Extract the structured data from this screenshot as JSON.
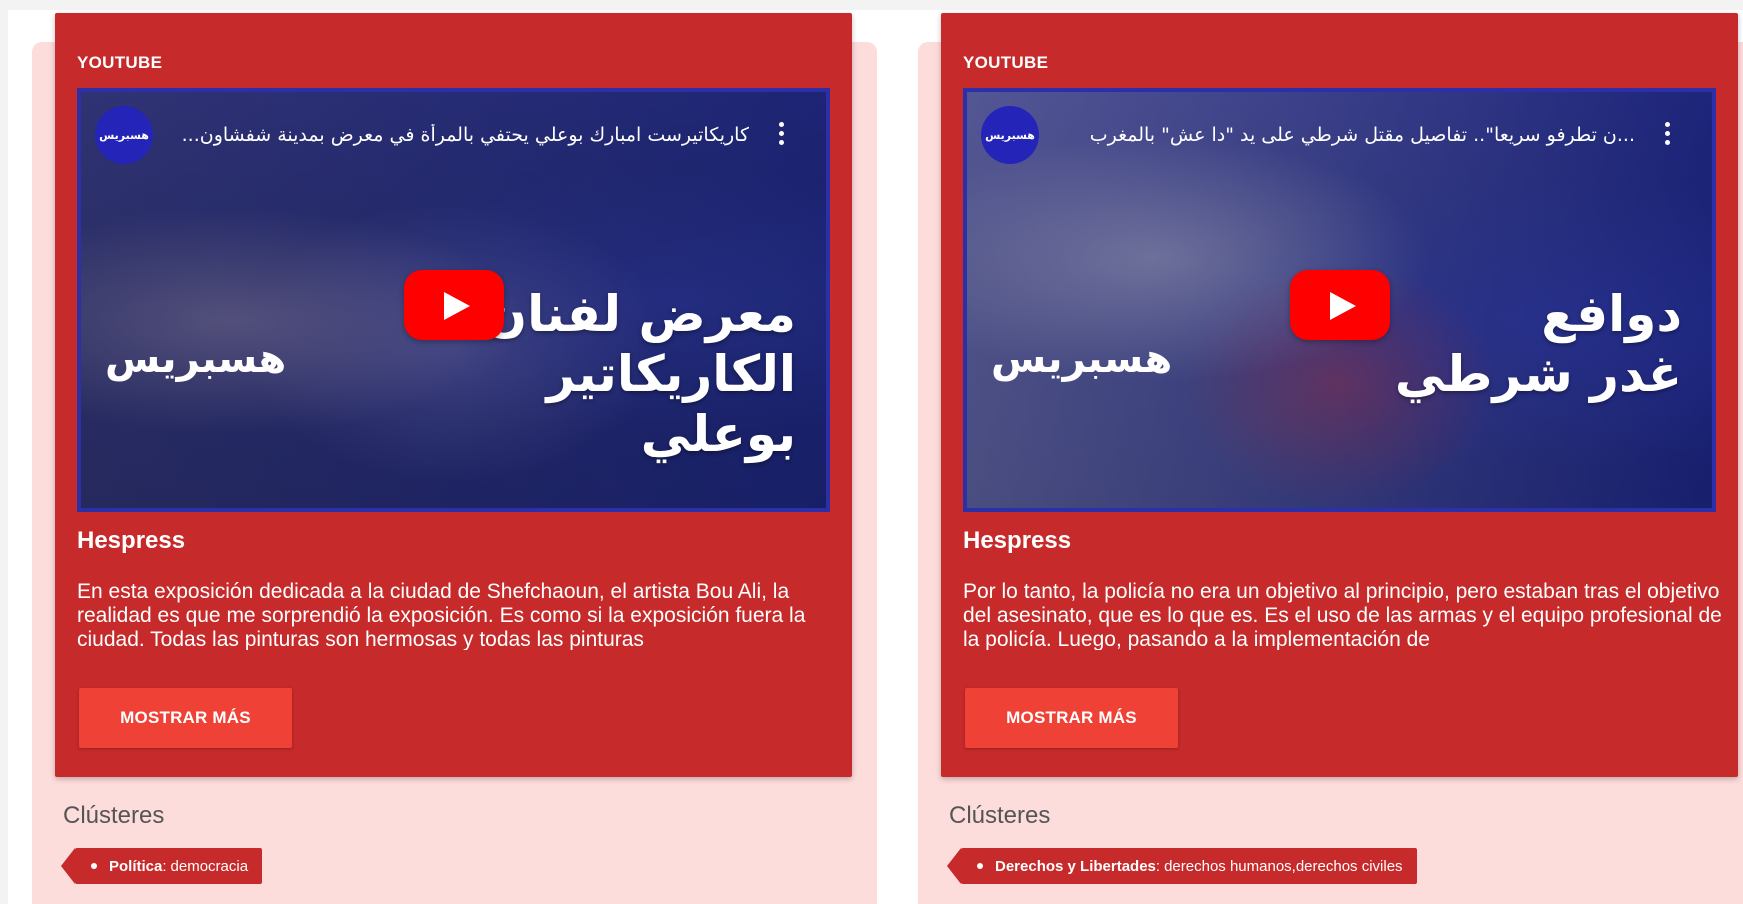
{
  "cards": [
    {
      "source": "YOUTUBE",
      "video": {
        "channel_avatar_text": "هسبريس",
        "title": "كاريكاتيرست امبارك بوعلي يحتفي بالمرأة في معرض بمدينة شفشاون...",
        "overlay_line1": "معرض لفنان",
        "overlay_line2": "الكاريكاتير بوعلي",
        "overlay_logo": "هسبريس",
        "play_icon": "play-icon",
        "menu_icon": "more-vert-icon"
      },
      "title": "Hespress",
      "body": "En esta exposición dedicada a la ciudad de Shefchaoun, el artista Bou Ali, la realidad es que me sorprendió la exposición. Es como si la exposición fuera la ciudad. Todas las pinturas son hermosas y todas las pinturas",
      "more_label": "MOSTRAR MÁS",
      "clusters_label": "Clústeres",
      "tag": {
        "category": "Política",
        "value": "democracia"
      }
    },
    {
      "source": "YOUTUBE",
      "video": {
        "channel_avatar_text": "هسبريس",
        "title": "...ن تطرفو سريعا\".. تفاصيل مقتل شرطي على يد \"دا عش\" بالمغرب",
        "overlay_line1": "دوافع",
        "overlay_line2": "غدر شرطي",
        "overlay_logo": "هسبريس",
        "play_icon": "play-icon",
        "menu_icon": "more-vert-icon"
      },
      "title": "Hespress",
      "body": "Por lo tanto, la policía no era un objetivo al principio, pero estaban tras el objetivo del asesinato, que es lo que es. Es el uso de las armas y el equipo profesional de la policía. Luego, pasando a la implementación de",
      "more_label": "MOSTRAR MÁS",
      "clusters_label": "Clústeres",
      "tag": {
        "category": "Derechos y Libertades",
        "value": "derechos humanos,derechos civiles"
      }
    }
  ],
  "colors": {
    "card_red": "#c62a2a",
    "button_red": "#ef4136",
    "panel_pink": "#fddcdc",
    "youtube_red": "#ff0000",
    "video_border_blue": "#2b2fa8"
  }
}
